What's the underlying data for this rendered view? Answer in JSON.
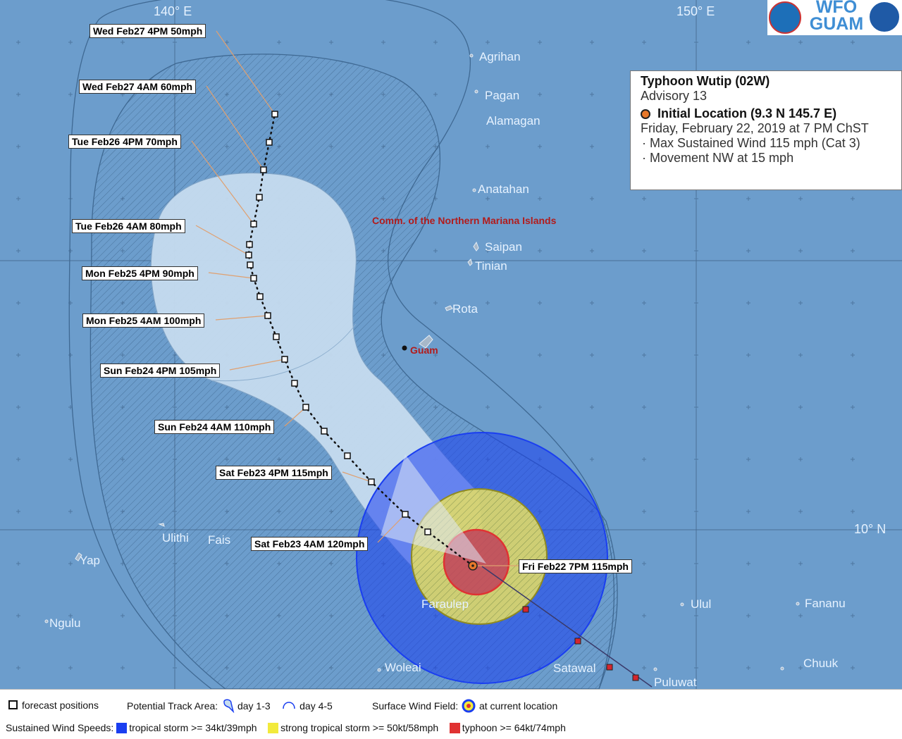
{
  "header": {
    "lon_140": "140° E",
    "lon_150": "150° E",
    "lat_10": "10° N",
    "logo_text": "WFO GUAM",
    "logo_line1": "WFO",
    "logo_line2": "GUAM",
    "noaa": "NOAA"
  },
  "info": {
    "title": "Typhoon Wutip (02W)",
    "advisory": "Advisory 13",
    "initial_location": "Initial Location (9.3 N 145.7 E)",
    "datetime": "Friday, February 22, 2019 at 7 PM ChST",
    "max_wind": "Max Sustained Wind 115 mph (Cat 3)",
    "movement": "Movement NW at 15 mph"
  },
  "islands": {
    "agrihan": "Agrihan",
    "pagan": "Pagan",
    "alamagan": "Alamagan",
    "anatahan": "Anatahan",
    "saipan": "Saipan",
    "tinian": "Tinian",
    "rota": "Rota",
    "guam": "Guam",
    "ulithi": "Ulithi",
    "fais": "Fais",
    "yap": "Yap",
    "ngulu": "Ngulu",
    "faraulep": "Faraulep",
    "woleai": "Woleai",
    "satawal": "Satawal",
    "puluwat": "Puluwat",
    "ulul": "Ulul",
    "fananu": "Fananu",
    "chuuk": "Chuuk",
    "cnmi": "Comm. of the Northern Mariana Islands"
  },
  "forecast": [
    "Fri Feb22 7PM  115mph",
    "Sat Feb23 4AM  120mph",
    "Sat Feb23 4PM  115mph",
    "Sun Feb24 4AM  110mph",
    "Sun Feb24 4PM  105mph",
    "Mon Feb25 4AM  100mph",
    "Mon Feb25 4PM  90mph",
    "Tue Feb26 4AM  80mph",
    "Tue Feb26 4PM  70mph",
    "Wed Feb27 4AM  60mph",
    "Wed Feb27 4PM  50mph"
  ],
  "legend": {
    "forecast_positions": "forecast positions",
    "potential_track_area": "Potential Track Area:",
    "day13": "day 1-3",
    "day45": "day 4-5",
    "surface_wind_field": "Surface Wind Field:",
    "at_current": "at current location",
    "sustained": "Sustained Wind Speeds:",
    "ts": "tropical storm >= 34kt/39mph",
    "sts": "strong tropical storm >= 50kt/58mph",
    "ty": "typhoon >= 64kt/74mph"
  },
  "colors": {
    "ocean": "#6c9dcc",
    "cone13": "#c6dcef",
    "ts": "#1a3ef0",
    "sts": "#f2ea3c",
    "typhoon": "#e03232",
    "center": "#e8782a"
  }
}
